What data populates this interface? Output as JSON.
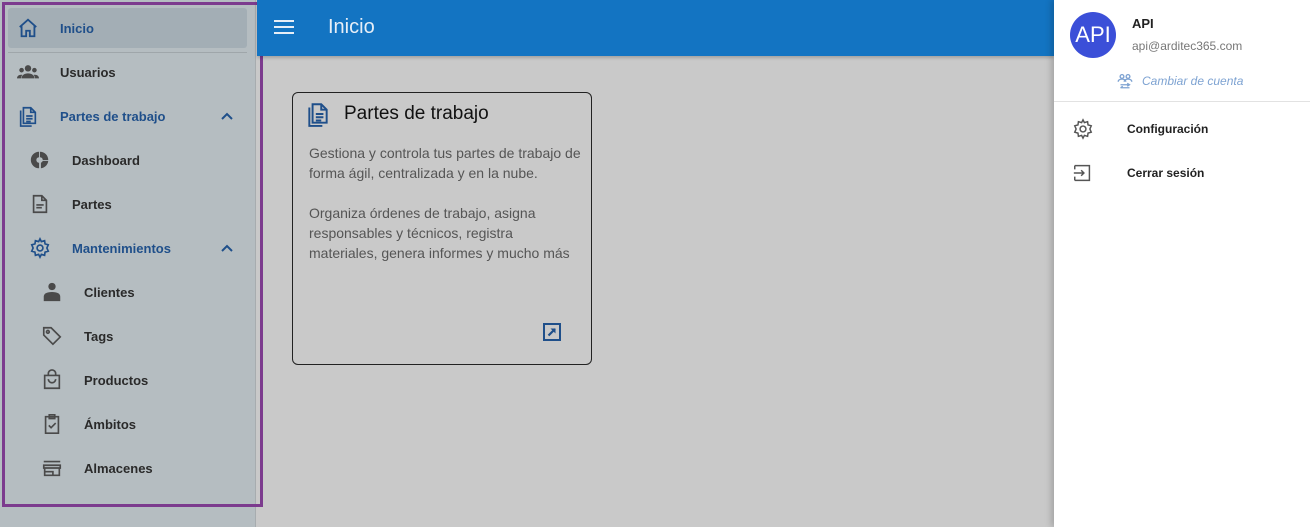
{
  "sidebar": {
    "items": [
      {
        "label": "Inicio",
        "icon": "home-icon"
      },
      {
        "label": "Usuarios",
        "icon": "users-icon"
      },
      {
        "label": "Partes de trabajo",
        "icon": "documents-icon"
      },
      {
        "label": "Dashboard",
        "icon": "dashboard-icon"
      },
      {
        "label": "Partes",
        "icon": "document-icon"
      },
      {
        "label": "Mantenimientos",
        "icon": "gear-icon"
      },
      {
        "label": "Clientes",
        "icon": "client-icon"
      },
      {
        "label": "Tags",
        "icon": "tag-icon"
      },
      {
        "label": "Productos",
        "icon": "bag-icon"
      },
      {
        "label": "Ámbitos",
        "icon": "clipboard-check-icon"
      },
      {
        "label": "Almacenes",
        "icon": "store-icon"
      }
    ]
  },
  "header": {
    "title": "Inicio"
  },
  "card": {
    "title": "Partes de trabajo",
    "paragraph1": "Gestiona y controla tus partes de trabajo de forma ágil, centralizada y en la nube.",
    "paragraph2": "Organiza órdenes de trabajo, asigna responsables y técnicos, registra materiales, genera informes y mucho más"
  },
  "account": {
    "avatar_text": "API",
    "name": "API",
    "email": "api@arditec365.com",
    "switch_label": "Cambiar de cuenta",
    "menu": [
      {
        "label": "Configuración",
        "icon": "gear-icon"
      },
      {
        "label": "Cerrar sesión",
        "icon": "logout-icon"
      }
    ]
  },
  "colors": {
    "accent": "#1374c2",
    "avatar": "#3b4fd8",
    "highlight": "#7c3b8e"
  }
}
